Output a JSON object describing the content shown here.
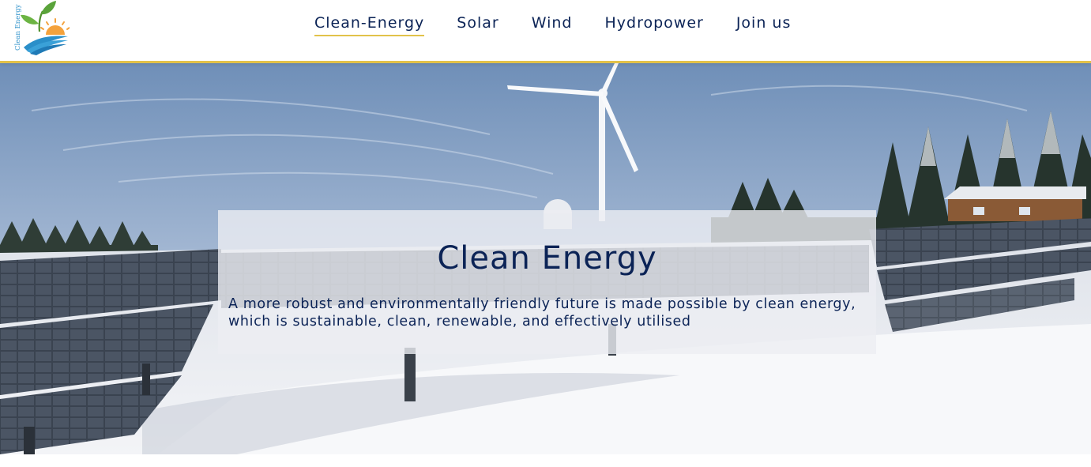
{
  "brand": {
    "logo_text": "Clean Energy"
  },
  "nav": {
    "items": [
      {
        "label": "Clean-Energy",
        "active": true
      },
      {
        "label": "Solar",
        "active": false
      },
      {
        "label": "Wind",
        "active": false
      },
      {
        "label": "Hydropower",
        "active": false
      },
      {
        "label": "Join us",
        "active": false
      }
    ]
  },
  "hero": {
    "title": "Clean Energy",
    "description": "A more robust and environmentally friendly future is made possible by clean energy, which is sustainable, clean, renewable, and effectively utilised"
  },
  "colors": {
    "text": "#0b2356",
    "accent": "#e2c24a",
    "leaf": "#5aa33a",
    "sun": "#f4a23c",
    "water": "#2a8fc9"
  }
}
